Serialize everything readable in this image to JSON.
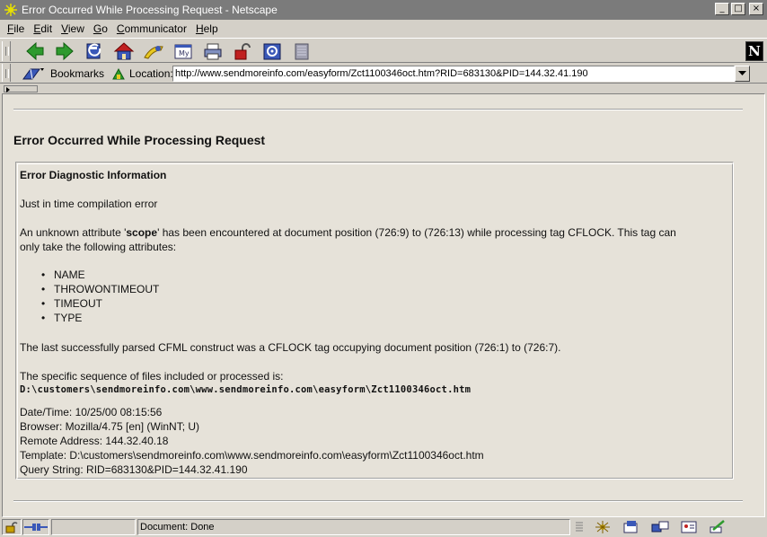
{
  "window": {
    "title": "Error Occurred While Processing Request - Netscape",
    "buttons": {
      "minimize": "_",
      "maximize": "□",
      "close": "×"
    }
  },
  "menu": [
    {
      "u": "F",
      "rest": "ile"
    },
    {
      "u": "E",
      "rest": "dit"
    },
    {
      "u": "V",
      "rest": "iew"
    },
    {
      "u": "G",
      "rest": "o"
    },
    {
      "u": "C",
      "rest": "ommunicator"
    },
    {
      "u": "H",
      "rest": "elp"
    }
  ],
  "toolbar": {
    "icons": [
      "back-icon",
      "forward-icon",
      "reload-icon",
      "home-icon",
      "search-icon",
      "my-netscape-icon",
      "print-icon",
      "security-icon",
      "shop-icon",
      "stop-icon"
    ],
    "my_label": "My",
    "logo_letter": "N"
  },
  "location_bar": {
    "bookmarks_label": "Bookmarks",
    "location_label": "Location:",
    "url": "http://www.sendmoreinfo.com/easyform/Zct1100346oct.htm?RID=683130&PID=144.32.41.190"
  },
  "page": {
    "title": "Error Occurred While Processing Request",
    "diag_heading": "Error Diagnostic Information",
    "jit_error": "Just in time compilation error",
    "unknown_attr_pre": "An unknown attribute '",
    "unknown_attr_name": "scope",
    "unknown_attr_post": "' has been encountered at document position (726:9) to (726:13) while processing tag CFLOCK. This tag can",
    "unknown_attr_line2": "only take the following attributes:",
    "attributes": [
      "NAME",
      "THROWONTIMEOUT",
      "TIMEOUT",
      "TYPE"
    ],
    "last_parsed": "The last successfully parsed CFML construct was a CFLOCK tag occupying document position (726:1) to (726:7).",
    "sequence_label": "The specific sequence of files included or processed is:",
    "sequence_path": "D:\\customers\\sendmoreinfo.com\\www.sendmoreinfo.com\\easyform\\Zct1100346oct.htm",
    "datetime": "Date/Time: 10/25/00 08:15:56",
    "browser": "Browser: Mozilla/4.75 [en] (WinNT; U)",
    "remote": "Remote Address: 144.32.40.18",
    "template": "Template: D:\\customers\\sendmoreinfo.com\\www.sendmoreinfo.com\\easyform\\Zct1100346oct.htm",
    "query": "Query String: RID=683130&PID=144.32.41.190"
  },
  "status": {
    "text": "Document: Done"
  }
}
